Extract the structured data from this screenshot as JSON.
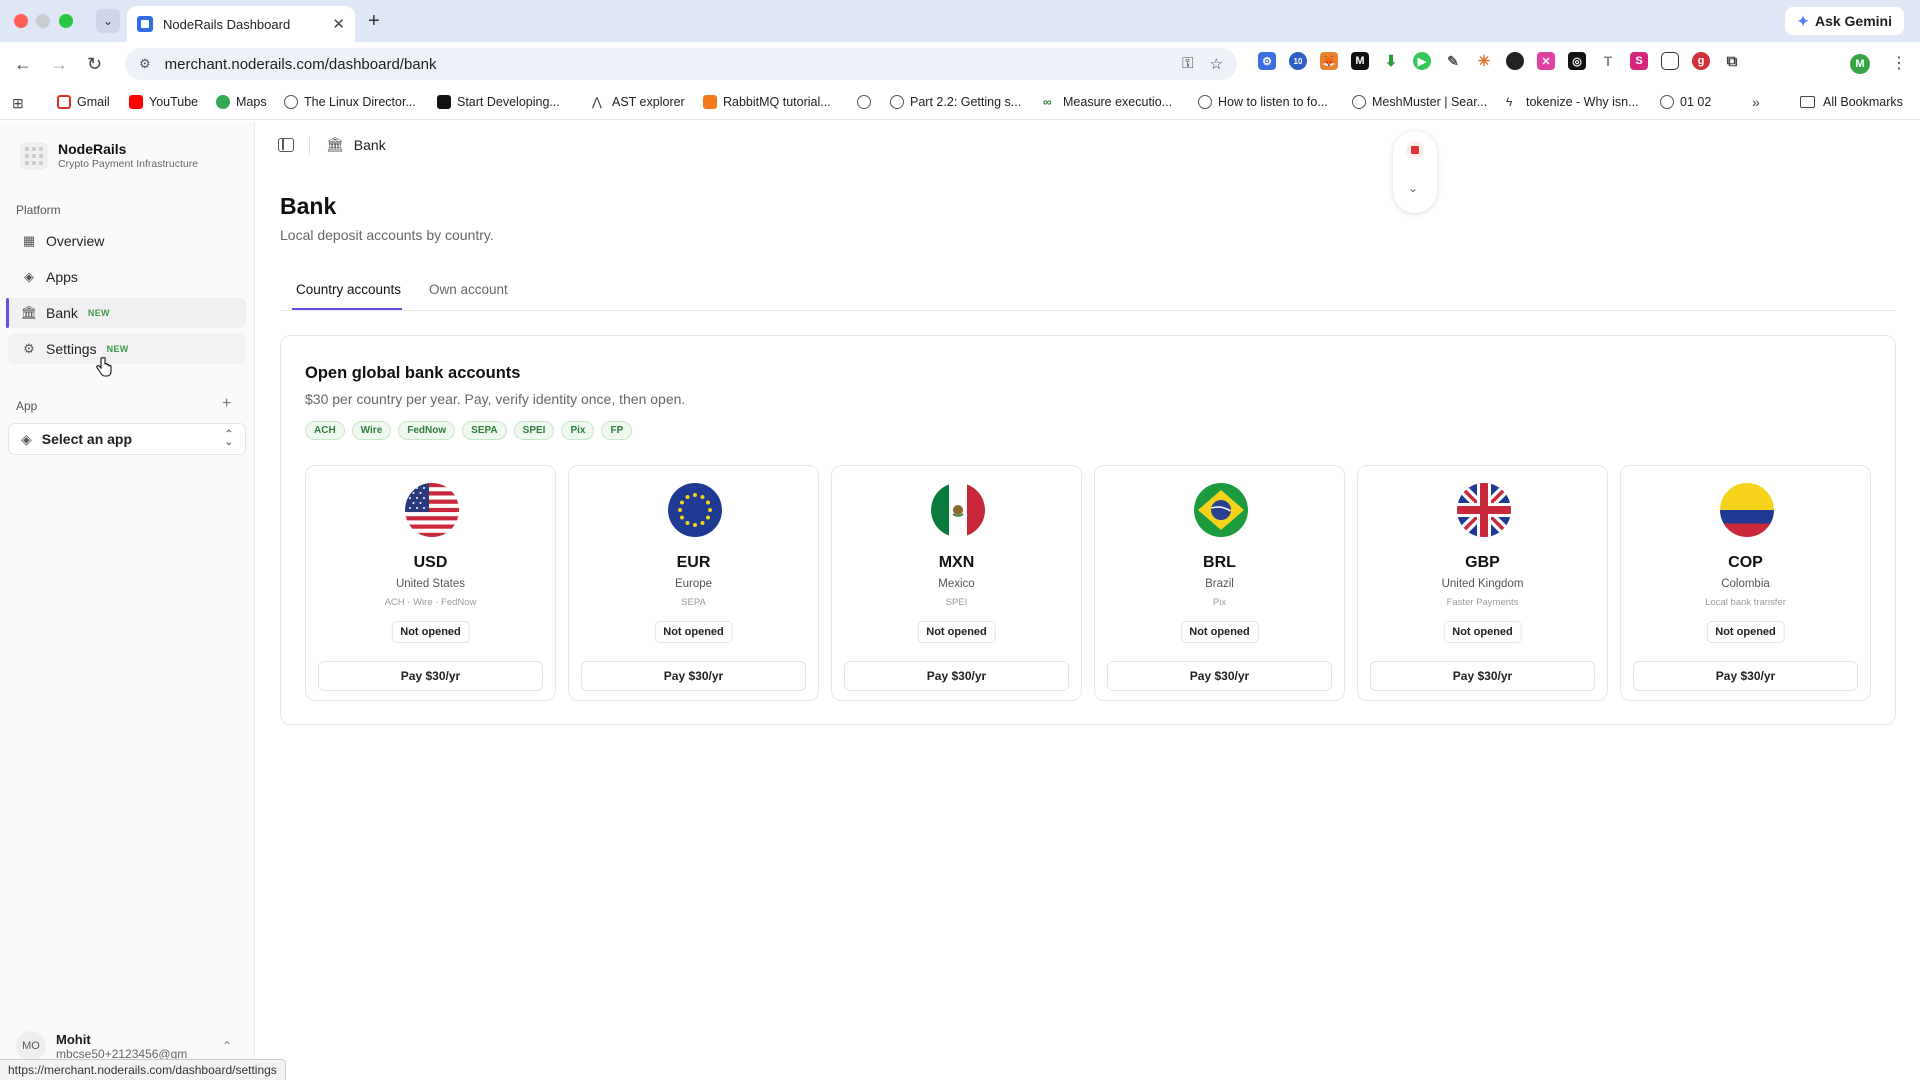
{
  "browser": {
    "tab_title": "NodeRails Dashboard",
    "url": "merchant.noderails.com/dashboard/bank",
    "ask_gemini": "Ask Gemini",
    "profile_initial": "M",
    "ext_badge": "10",
    "bookmarks": [
      "Gmail",
      "YouTube",
      "Maps",
      "The Linux Director...",
      "Start Developing...",
      "AST explorer",
      "RabbitMQ tutorial...",
      "",
      "Part 2.2: Getting s...",
      "Measure executio...",
      "How to listen to fo...",
      "MeshMuster | Sear...",
      "tokenize - Why isn...",
      "01 02"
    ],
    "all_bookmarks": "All Bookmarks",
    "status_url": "https://merchant.noderails.com/dashboard/settings"
  },
  "sidebar": {
    "brand_name": "NodeRails",
    "brand_sub": "Crypto Payment Infrastructure",
    "platform_label": "Platform",
    "items": [
      {
        "label": "Overview",
        "icon": "grid-icon"
      },
      {
        "label": "Apps",
        "icon": "layers-icon"
      },
      {
        "label": "Bank",
        "icon": "bank-icon",
        "badge": "NEW"
      },
      {
        "label": "Settings",
        "icon": "gear-icon",
        "badge": "NEW"
      }
    ],
    "app_label": "App",
    "app_select": "Select an app",
    "user_name": "Mohit",
    "user_email": "mbcse50+2123456@gm",
    "user_initials": "MO"
  },
  "header": {
    "breadcrumb": "Bank"
  },
  "page": {
    "title": "Bank",
    "subtitle": "Local deposit accounts by country.",
    "tabs": [
      "Country accounts",
      "Own account"
    ],
    "active_tab": "Country accounts"
  },
  "card": {
    "title": "Open global bank accounts",
    "subtitle": "$30 per country per year. Pay, verify identity once, then open.",
    "rails": [
      "ACH",
      "Wire",
      "FedNow",
      "SEPA",
      "SPEI",
      "Pix",
      "FP"
    ],
    "currencies": [
      {
        "code": "USD",
        "country": "United States",
        "rails": "ACH · Wire · FedNow",
        "status": "Not opened",
        "button": "Pay $30/yr"
      },
      {
        "code": "EUR",
        "country": "Europe",
        "rails": "SEPA",
        "status": "Not opened",
        "button": "Pay $30/yr"
      },
      {
        "code": "MXN",
        "country": "Mexico",
        "rails": "SPEI",
        "status": "Not opened",
        "button": "Pay $30/yr"
      },
      {
        "code": "BRL",
        "country": "Brazil",
        "rails": "Pix",
        "status": "Not opened",
        "button": "Pay $30/yr"
      },
      {
        "code": "GBP",
        "country": "United Kingdom",
        "rails": "Faster Payments",
        "status": "Not opened",
        "button": "Pay $30/yr"
      },
      {
        "code": "COP",
        "country": "Colombia",
        "rails": "Local bank transfer",
        "status": "Not opened",
        "button": "Pay $30/yr"
      }
    ]
  },
  "colors": {
    "accent": "#6b4de6",
    "badge_green": "#3f9a4a",
    "record_red": "#e0303a"
  }
}
